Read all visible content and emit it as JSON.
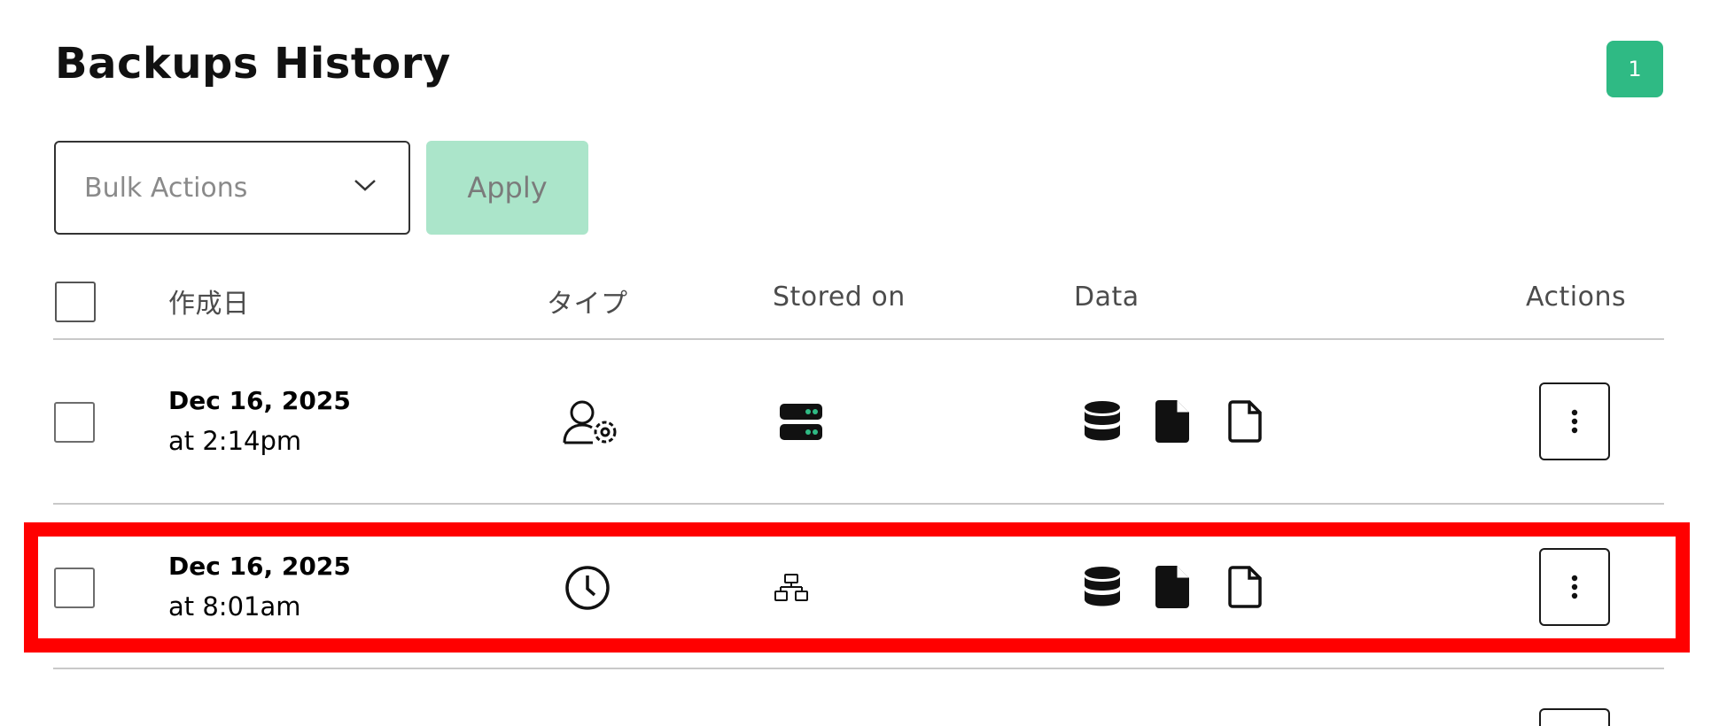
{
  "page": {
    "title": "Backups History",
    "badge_count": "1"
  },
  "toolbar": {
    "bulk_actions_label": "Bulk Actions",
    "apply_label": "Apply"
  },
  "table": {
    "headers": {
      "created": "作成日",
      "type": "タイプ",
      "stored_on": "Stored on",
      "data": "Data",
      "actions": "Actions"
    },
    "rows": [
      {
        "date": "Dec 16, 2025",
        "time": "at 2:14pm",
        "type_icon": "user-gear-icon",
        "stored_icon": "server-icon",
        "data_icons": [
          "database-icon",
          "file-solid-icon",
          "file-outline-icon"
        ]
      },
      {
        "date": "Dec 16, 2025",
        "time": "at 8:01am",
        "type_icon": "clock-icon",
        "stored_icon": "network-icon",
        "data_icons": [
          "database-icon",
          "file-solid-icon",
          "file-outline-icon"
        ]
      }
    ]
  },
  "colors": {
    "accent": "#2fba84",
    "apply_disabled": "#abe5ca",
    "highlight": "#ff0000"
  }
}
